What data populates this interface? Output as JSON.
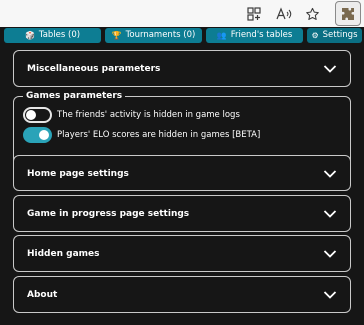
{
  "browser_toolbar": {
    "icons": [
      "tab-grid-icon",
      "read-aloud-icon",
      "favorite-star-icon",
      "extension-puzzle-icon"
    ]
  },
  "tabs": [
    {
      "label": "Tables (0)",
      "icon": "dice-icon"
    },
    {
      "label": "Tournaments (0)",
      "icon": "trophy-icon"
    },
    {
      "label": "Friend's tables",
      "icon": "friends-icon"
    },
    {
      "label": "Settings",
      "icon": "gear-icon"
    }
  ],
  "sections": {
    "misc": "Miscellaneous parameters",
    "games_params": "Games parameters",
    "home": "Home page settings",
    "in_progress": "Game in progress page settings",
    "hidden": "Hidden games",
    "about": "About"
  },
  "options": {
    "friends_activity": {
      "label": "The friends' activity is hidden in game logs",
      "enabled": false
    },
    "elo_hidden": {
      "label": "Players' ELO scores are hidden in games [BETA]",
      "enabled": true
    }
  },
  "colors": {
    "accent": "#0d7d93",
    "toggle_on": "#2aa3b8",
    "background": "#161616",
    "border": "#c9c9c9"
  }
}
